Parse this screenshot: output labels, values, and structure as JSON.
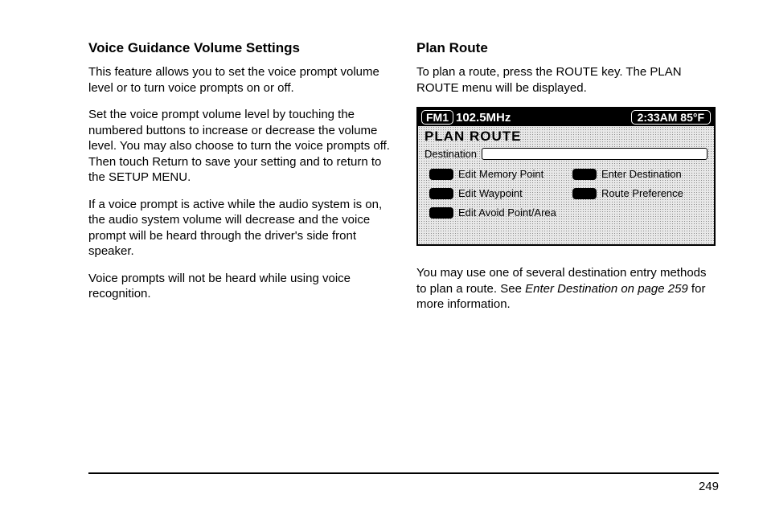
{
  "left": {
    "heading": "Voice Guidance Volume Settings",
    "p1": "This feature allows you to set the voice prompt volume level or to turn voice prompts on or off.",
    "p2": "Set the voice prompt volume level by touching the numbered buttons to increase or decrease the volume level. You may also choose to turn the voice prompts off. Then touch Return to save your setting and to return to the SETUP MENU.",
    "p3": "If a voice prompt is active while the audio system is on, the audio system volume will decrease and the voice prompt will be heard through the driver's side front speaker.",
    "p4": "Voice prompts will not be heard while using voice recognition."
  },
  "right": {
    "heading": "Plan Route",
    "p1": "To plan a route, press the ROUTE key. The PLAN ROUTE menu will be displayed.",
    "p2a": "You may use one of several destination entry methods to plan a route. See ",
    "p2b": "Enter Destination on page 259",
    "p2c": " for more information."
  },
  "screen": {
    "band": "FM1",
    "freq": "102.5MHz",
    "time": "2:33AM 85°F",
    "title": "PLAN ROUTE",
    "dest_label": "Destination",
    "buttons": [
      "Edit Memory Point",
      "Enter Destination",
      "Edit Waypoint",
      "Route Preference",
      "Edit Avoid Point/Area"
    ]
  },
  "page_number": "249"
}
